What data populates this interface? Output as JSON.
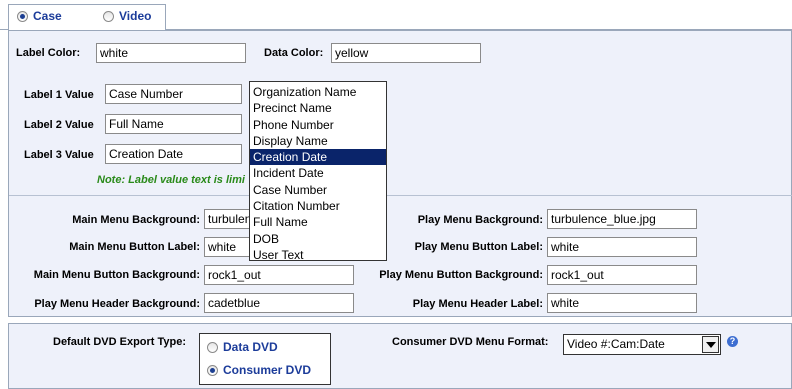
{
  "tabs": [
    {
      "label": "Case",
      "selected": true
    },
    {
      "label": "Video",
      "selected": false
    }
  ],
  "colors": {
    "label_color_label": "Label Color:",
    "label_color_value": "white",
    "data_color_label": "Data Color:",
    "data_color_value": "yellow"
  },
  "labels": [
    {
      "label": "Label 1 Value",
      "value": "Case Number"
    },
    {
      "label": "Label 2 Value",
      "value": "Full Name"
    },
    {
      "label": "Label 3 Value",
      "value": "Creation Date"
    }
  ],
  "note": "Note: Label value text is limi",
  "dropdown": {
    "options": [
      "Organization Name",
      "Precinct Name",
      "Phone Number",
      "Display Name",
      "Creation Date",
      "Incident Date",
      "Case Number",
      "Citation Number",
      "Full Name",
      "DOB",
      "User Text"
    ],
    "selected": "Creation Date"
  },
  "menus": {
    "main_bg_label": "Main Menu Background:",
    "main_bg_value": "turbulence_blue.jpg",
    "main_btn_label_label": "Main Menu Button Label:",
    "main_btn_label_value": "white",
    "main_btn_bg_label": "Main Menu Button Background:",
    "main_btn_bg_value": "rock1_out",
    "play_header_bg_label": "Play Menu Header Background:",
    "play_header_bg_value": "cadetblue",
    "play_bg_label": "Play Menu Background:",
    "play_bg_value": "turbulence_blue.jpg",
    "play_btn_label_label": "Play Menu Button Label:",
    "play_btn_label_value": "white",
    "play_btn_bg_label": "Play Menu Button Background:",
    "play_btn_bg_value": "rock1_out",
    "play_header_label_label": "Play Menu Header Label:",
    "play_header_label_value": "white"
  },
  "export": {
    "type_label": "Default DVD Export Type:",
    "options": [
      {
        "label": "Data DVD",
        "selected": false
      },
      {
        "label": "Consumer DVD",
        "selected": true
      }
    ],
    "format_label": "Consumer DVD Menu Format:",
    "format_value": "Video #:Cam:Date",
    "help_icon": "help-icon"
  }
}
